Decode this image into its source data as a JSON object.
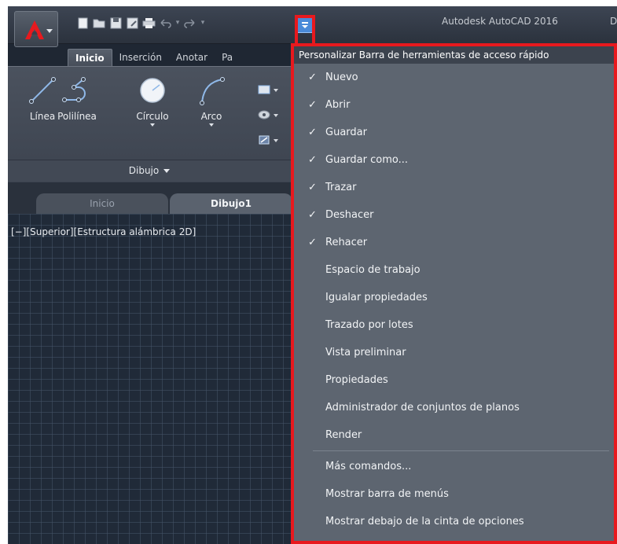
{
  "window": {
    "title": "Autodesk AutoCAD 2016",
    "title_trailing": "D"
  },
  "qat": {
    "icons": [
      "new-icon",
      "open-icon",
      "save-icon",
      "save-as-icon",
      "plot-icon",
      "undo-icon",
      "redo-icon",
      "customize-qat-icon"
    ]
  },
  "ribbon": {
    "tabs": [
      "Inicio",
      "Inserción",
      "Anotar",
      "Pa"
    ],
    "active_tab": "Inicio",
    "tools": {
      "linea": "Línea",
      "polilinea": "Polilínea",
      "circulo": "Círculo",
      "arco": "Arco"
    },
    "panel_title": "Dibujo"
  },
  "file_tabs": {
    "start": "Inicio",
    "drawing": "Dibujo1"
  },
  "viewport": {
    "label": "[−][Superior][Estructura alámbrica 2D]"
  },
  "menu": {
    "header": "Personalizar Barra de herramientas de acceso rápido",
    "items": [
      {
        "label": "Nuevo",
        "checked": true
      },
      {
        "label": "Abrir",
        "checked": true
      },
      {
        "label": "Guardar",
        "checked": true
      },
      {
        "label": "Guardar como...",
        "checked": true
      },
      {
        "label": "Trazar",
        "checked": true
      },
      {
        "label": "Deshacer",
        "checked": true
      },
      {
        "label": "Rehacer",
        "checked": true
      },
      {
        "label": "Espacio de trabajo",
        "checked": false
      },
      {
        "label": "Igualar propiedades",
        "checked": false
      },
      {
        "label": "Trazado por lotes",
        "checked": false
      },
      {
        "label": "Vista preliminar",
        "checked": false
      },
      {
        "label": "Propiedades",
        "checked": false
      },
      {
        "label": "Administrador de conjuntos de planos",
        "checked": false
      },
      {
        "label": "Render",
        "checked": false
      }
    ],
    "extra_items": [
      {
        "label": "Más comandos..."
      },
      {
        "label": "Mostrar barra de menús"
      },
      {
        "label": "Mostrar debajo de la cinta de opciones"
      }
    ],
    "check_glyph": "✓"
  },
  "colors": {
    "highlight": "#e8191e",
    "menu_bg": "#5d6570",
    "canvas_bg": "#202a38"
  }
}
